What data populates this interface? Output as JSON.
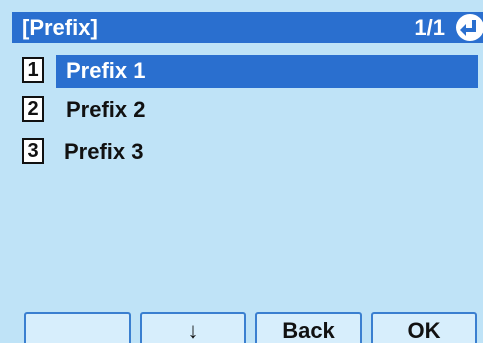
{
  "header": {
    "title": "[Prefix]",
    "page": "1/1",
    "back_icon": "return-arrow-icon"
  },
  "list": {
    "items": [
      {
        "number": "1",
        "label": "Prefix 1",
        "selected": true
      },
      {
        "number": "2",
        "label": "Prefix 2",
        "selected": false
      },
      {
        "number": "3",
        "label": "Prefix 3",
        "selected": false
      }
    ]
  },
  "softkeys": [
    {
      "label": ""
    },
    {
      "label": "↓"
    },
    {
      "label": "Back"
    },
    {
      "label": "OK"
    }
  ],
  "colors": {
    "header_bg": "#2a6fcf",
    "screen_bg": "#bfe3f7",
    "selection_bg": "#2a6fcf"
  }
}
